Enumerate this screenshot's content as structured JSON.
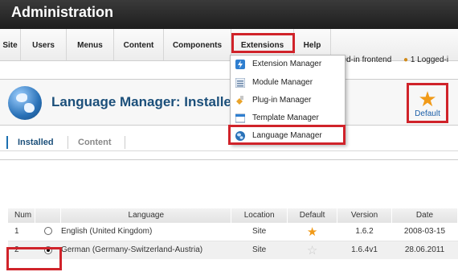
{
  "header": {
    "title": "Administration"
  },
  "menu": {
    "items": [
      "Site",
      "Users",
      "Menus",
      "Content",
      "Components",
      "Extensions",
      "Help"
    ]
  },
  "status": {
    "frontend": "ged-in frontend",
    "backend": "1 Logged-i"
  },
  "extensions_menu": {
    "items": [
      {
        "label": "Extension Manager",
        "icon": "plugin-bolt-icon"
      },
      {
        "label": "Module Manager",
        "icon": "module-list-icon"
      },
      {
        "label": "Plug-in Manager",
        "icon": "plugin-icon"
      },
      {
        "label": "Template Manager",
        "icon": "template-icon"
      },
      {
        "label": "Language Manager",
        "icon": "globe-icon"
      }
    ]
  },
  "page": {
    "title": "Language Manager: Installed"
  },
  "toolbar": {
    "default_label": "Default"
  },
  "tabs": {
    "installed": "Installed",
    "content": "Content"
  },
  "table": {
    "headers": {
      "num": "Num",
      "language": "Language",
      "location": "Location",
      "default": "Default",
      "version": "Version",
      "date": "Date"
    },
    "rows": [
      {
        "num": "1",
        "language": "English (United Kingdom)",
        "location": "Site",
        "is_default": true,
        "selected": false,
        "version": "1.6.2",
        "date": "2008-03-15"
      },
      {
        "num": "2",
        "language": "German (Germany-Switzerland-Austria)",
        "location": "Site",
        "is_default": false,
        "selected": true,
        "version": "1.6.4v1",
        "date": "28.06.2011"
      }
    ]
  },
  "colors": {
    "accent": "#d0232a",
    "title_blue": "#1b4f7a",
    "star": "#f19a18"
  }
}
